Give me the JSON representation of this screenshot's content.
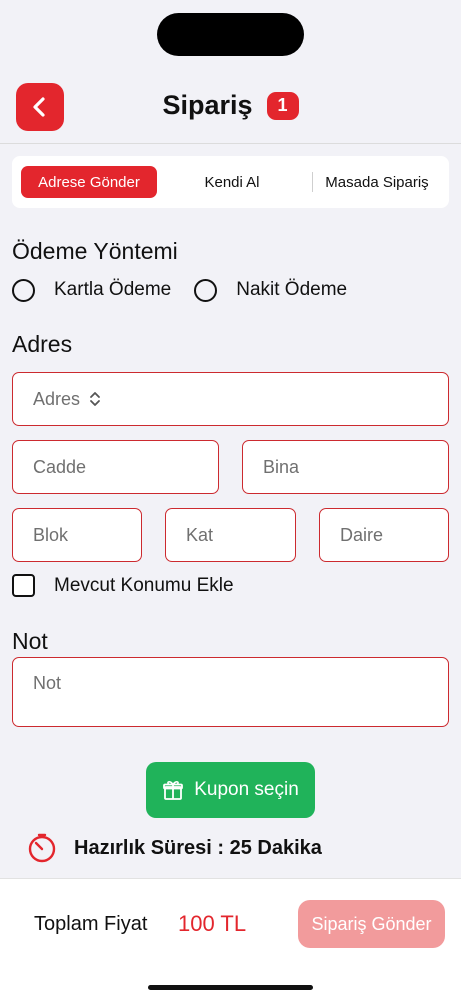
{
  "header": {
    "title": "Sipariş",
    "count": "1"
  },
  "tabs": [
    {
      "label": "Adrese Gönder",
      "active": true
    },
    {
      "label": "Kendi Al",
      "active": false
    },
    {
      "label": "Masada Sipariş",
      "active": false
    }
  ],
  "payment": {
    "title": "Ödeme Yöntemi",
    "options": [
      "Kartla Ödeme",
      "Nakit Ödeme"
    ]
  },
  "address": {
    "title": "Adres",
    "select_placeholder": "Adres",
    "street_placeholder": "Cadde",
    "building_placeholder": "Bina",
    "block_placeholder": "Blok",
    "floor_placeholder": "Kat",
    "apartment_placeholder": "Daire",
    "use_location_label": "Mevcut Konumu Ekle"
  },
  "note": {
    "title": "Not",
    "placeholder": "Not"
  },
  "coupon": {
    "label": "Kupon seçin"
  },
  "prep": {
    "text": "Hazırlık Süresi : 25 Dakika"
  },
  "footer": {
    "total_label": "Toplam Fiyat",
    "total_value": "100 TL",
    "submit_label": "Sipariş Gönder"
  },
  "colors": {
    "accent": "#e3262d",
    "coupon": "#20b35a",
    "submit_disabled": "#f29b9c",
    "field_border": "#cc2a2f"
  },
  "icons": [
    "chevron-left-icon",
    "select-arrows-icon",
    "gift-icon",
    "timer-icon"
  ]
}
